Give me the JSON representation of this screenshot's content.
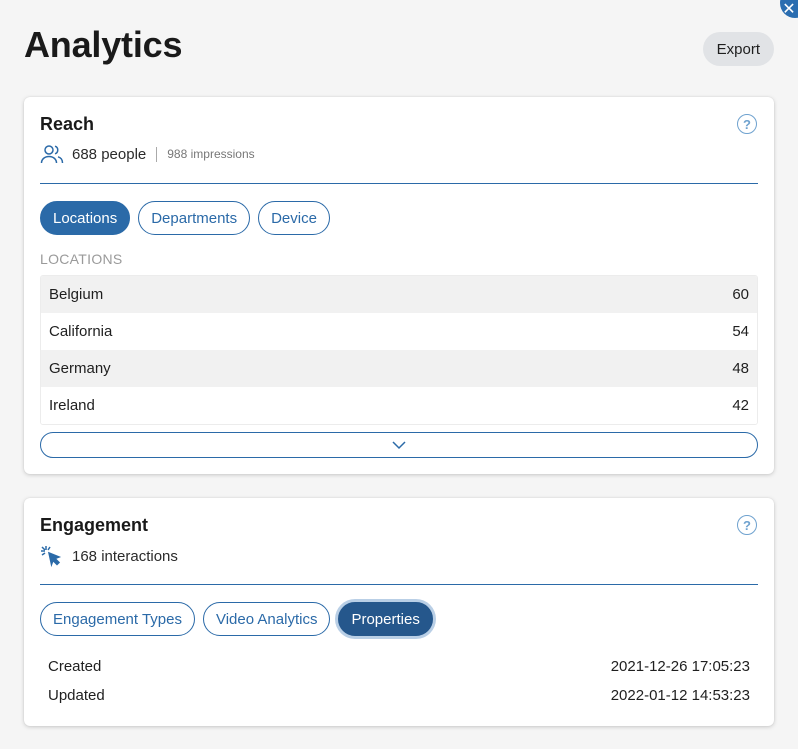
{
  "page": {
    "title": "Analytics",
    "export_label": "Export",
    "close_glyph": "✕"
  },
  "reach": {
    "title": "Reach",
    "help_glyph": "?",
    "people_text": "688 people",
    "impressions_text": "988 impressions",
    "tabs": [
      "Locations",
      "Departments",
      "Device"
    ],
    "active_tab": "Locations",
    "section_label": "LOCATIONS",
    "rows": [
      {
        "name": "Belgium",
        "value": "60"
      },
      {
        "name": "California",
        "value": "54"
      },
      {
        "name": "Germany",
        "value": "48"
      },
      {
        "name": "Ireland",
        "value": "42"
      }
    ]
  },
  "engagement": {
    "title": "Engagement",
    "help_glyph": "?",
    "interactions_text": "168 interactions",
    "tabs": [
      "Engagement Types",
      "Video Analytics",
      "Properties"
    ],
    "active_tab": "Properties",
    "properties": [
      {
        "label": "Created",
        "value": "2021-12-26 17:05:23"
      },
      {
        "label": "Updated",
        "value": "2022-01-12 14:53:23"
      }
    ]
  },
  "icons": {
    "people": "people-icon",
    "cursor_click": "cursor-click-icon",
    "chevron": "chevron-down-icon",
    "help": "help-icon",
    "close": "close-icon"
  },
  "colors": {
    "accent": "#2b6aa8",
    "accent_dark": "#25578c",
    "close_button": "#2a6db0"
  }
}
